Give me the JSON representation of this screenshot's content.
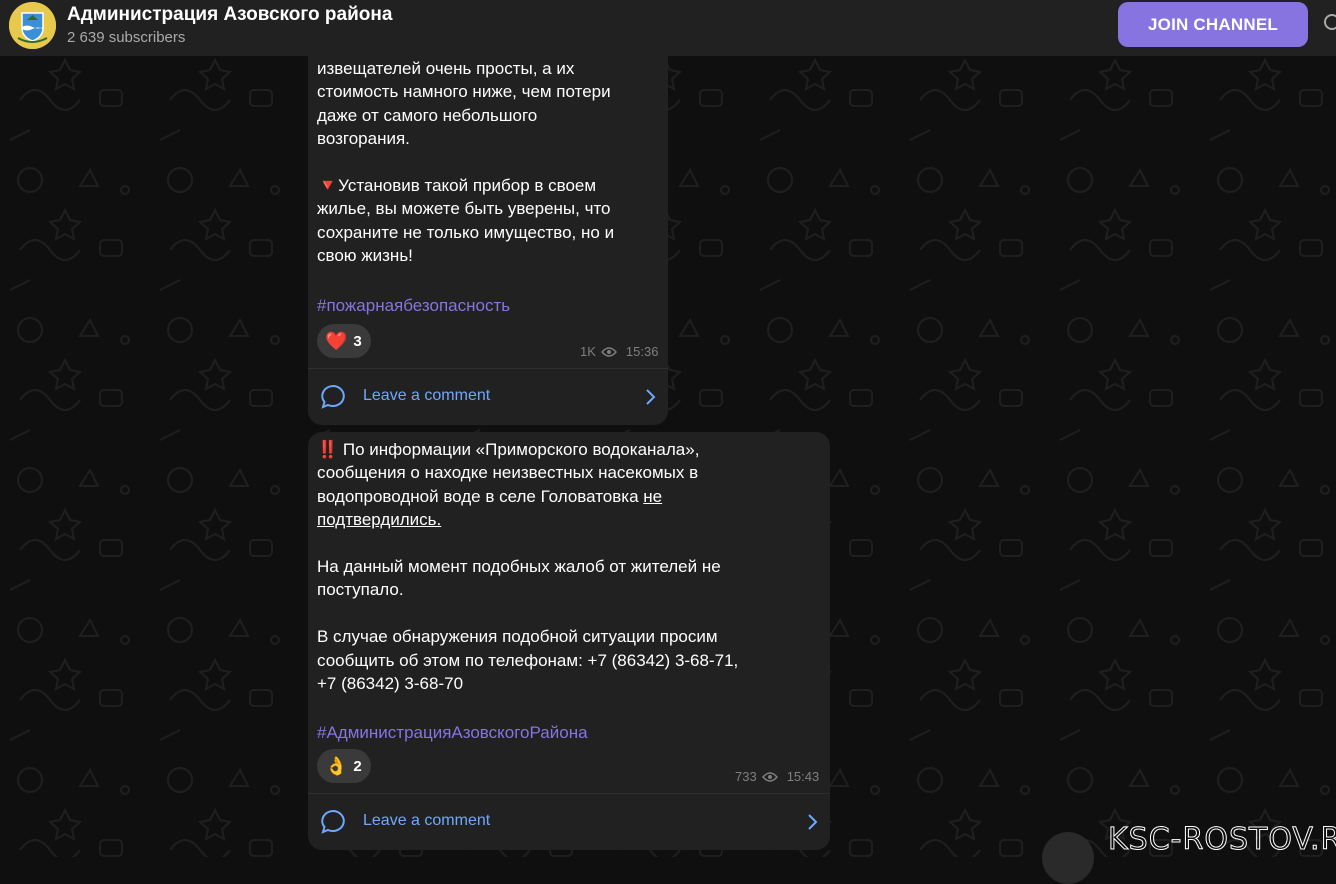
{
  "channel": {
    "title": "Администрация Азовского района",
    "subscribers": "2 639 subscribers",
    "join_label": "JOIN CHANNEL",
    "avatar_icon": "coat-of-arms-icon"
  },
  "colors": {
    "accent": "#8774e1",
    "link": "#6fa8ff",
    "bubble": "#212121",
    "header": "#212121",
    "background": "#0f0f0f"
  },
  "messages": [
    {
      "text": "извещателей очень просты, а их\nстоимость намного ниже, чем потери\nдаже от самого небольшого\nвозгорания.\n\n🔻Установив такой прибор в своем\nжилье, вы можете быть уверены, что\nсохраните не только имущество, но и\nсвою жизнь!",
      "hashtag": "#пожарнаябезопасность",
      "reaction": {
        "emoji": "❤️",
        "count": "3"
      },
      "views": "1K",
      "time": "15:36",
      "comment_label": "Leave a comment"
    },
    {
      "text_intro": "‼️ По информации «Приморского водоканала»,\nсообщения о находке неизвестных насекомых в\nводопроводной воде в селе Головатовка ",
      "text_underlined": "не\nподтвердились.",
      "text_rest": "На данный момент подобных жалоб от жителей не\nпоступало.\n\nВ случае обнаружения подобной ситуации просим\nсообщить об этом по телефонам: +7 (86342) 3-68-71,\n+7 (86342) 3-68-70",
      "hashtag": "#АдминистрацияАзовскогоРайона",
      "reaction": {
        "emoji": "👌",
        "count": "2"
      },
      "views": "733",
      "time": "15:43",
      "comment_label": "Leave a comment"
    }
  ],
  "watermark": "KSC-ROSTOV.RU"
}
